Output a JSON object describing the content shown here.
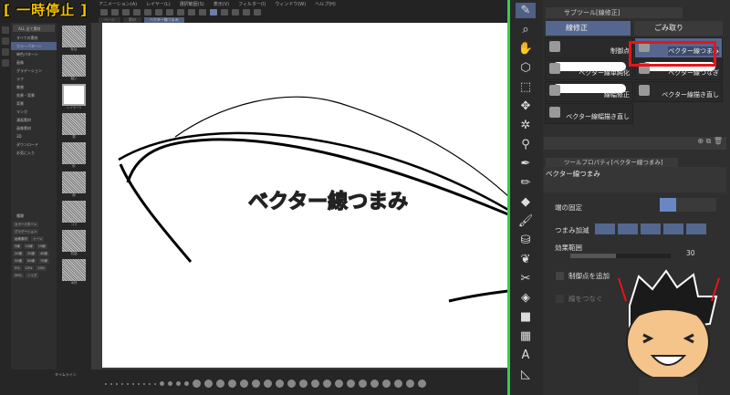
{
  "overlay": {
    "pause_label": "[ 一時停止 ]",
    "caption": "ベクター線つまみ"
  },
  "menu": [
    "アニメーション(A)",
    "レイヤー(L)",
    "選択範囲(S)",
    "表示(V)",
    "フィルター(I)",
    "ウィンドウ(W)",
    "ヘルプ(H)"
  ],
  "doc_tabs": [
    "ページ",
    "素材",
    "ベクター線つまみ"
  ],
  "material_tree": {
    "search_label": "ALL 全て素材",
    "items": [
      "すべての素材",
      "カラーパターン",
      "単色パターン",
      "画像",
      "グラデーション",
      "ラフ",
      "質感",
      "効果・背景",
      "背景",
      "マンガ",
      "漫画素材",
      "画像素材",
      "3D",
      "ダウンロード",
      "お気に入り"
    ],
    "selected": 1,
    "tags_heading": "種類",
    "tags": [
      "カラーパターン",
      "グラデーション",
      "画像素材",
      "トーン",
      "5線",
      "10線",
      "15線",
      "20線",
      "30線",
      "40線",
      "50線",
      "60線",
      "70線",
      "5%",
      "10%",
      "20%",
      "30%",
      "ノイズ"
    ]
  },
  "thumbnails": [
    "砂目",
    "粗い",
    "レイヤー1",
    "霧",
    "砂",
    "雨",
    "コマ",
    "質感",
    "木材"
  ],
  "timeline": {
    "label": "タイムライン"
  },
  "subtool": {
    "header": "サブツール[線修正]",
    "groups": [
      {
        "label": "線修正",
        "active": true
      },
      {
        "label": "ごみ取り",
        "active": false
      }
    ],
    "items": [
      {
        "label": "制御点",
        "selected": false
      },
      {
        "label": "ベクター線つまみ",
        "selected": true
      },
      {
        "label": "ベクター線単純化",
        "selected": false
      },
      {
        "label": "ベクター線つなぎ",
        "selected": false
      },
      {
        "label": "線幅修正",
        "selected": false
      },
      {
        "label": "ベクター線描き直し",
        "selected": false
      },
      {
        "label": "ベクター線幅描き直し",
        "selected": false
      }
    ],
    "highlight_color": "#e8141a"
  },
  "tool_property": {
    "header": "ツールプロパティ[ベクター線つまみ]",
    "name": "ベクター線つまみ",
    "end_fix_label": "端の固定",
    "pinch_label": "つまみ加減",
    "range_label": "効果範囲",
    "range_value": "30",
    "add_points_label": "制御点を追加",
    "connect_label": "線をつなぐ"
  },
  "colors": {
    "accent": "#4f5f85",
    "green_divider": "#2fd14a",
    "caption_yellow": "#ffee00"
  }
}
